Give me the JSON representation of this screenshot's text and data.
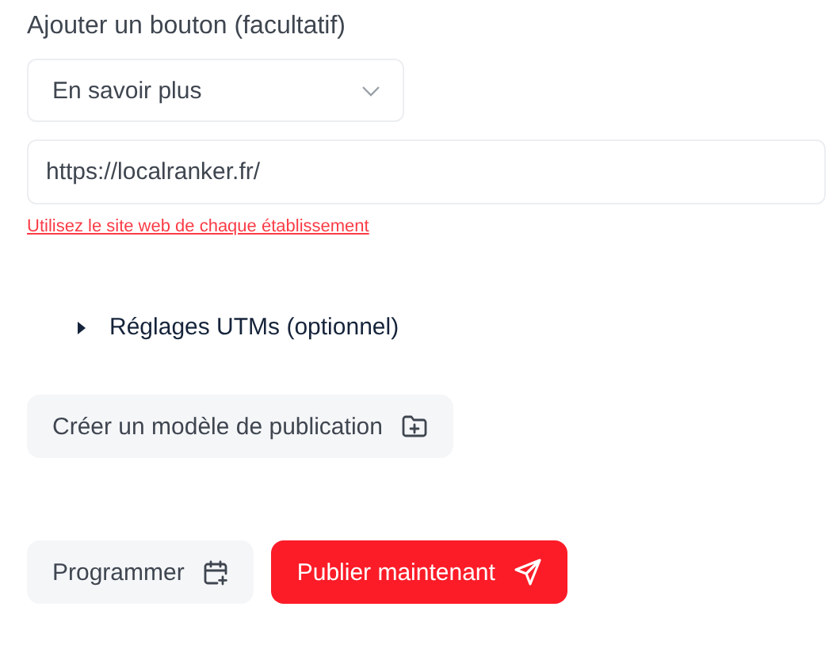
{
  "button_label": "Ajouter un bouton (facultatif)",
  "button_select": {
    "value": "En savoir plus"
  },
  "url_field": {
    "value": "https://localranker.fr/"
  },
  "url_hint": "Utilisez le site web de chaque établissement",
  "utm_toggle": {
    "label": "Réglages UTMs (optionnel)",
    "expanded": false
  },
  "template_button": {
    "label": "Créer un modèle de publication"
  },
  "actions": [
    {
      "label": "Programmer",
      "kind": "secondary"
    },
    {
      "label": "Publier maintenant",
      "kind": "primary"
    }
  ]
}
